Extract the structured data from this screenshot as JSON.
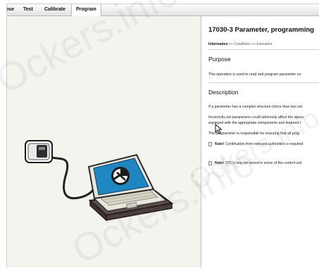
{
  "tabs": [
    {
      "label": "ose"
    },
    {
      "label": "Test"
    },
    {
      "label": "Calibrate"
    },
    {
      "label": "Program"
    }
  ],
  "right_panel": {
    "title": "17030-3 Parameter, programming",
    "breadcrumb": {
      "current": "Information",
      "sep1": ">>",
      "step2": "Conditions",
      "sep2": ">>",
      "step3": "Execution"
    },
    "purpose_heading": "Purpose",
    "purpose_text": "This operation is used to read and program parameter va",
    "description_heading": "Description",
    "description_lines": [
      "If a parameter has a complex structure (more than two val",
      "Incorrectly set parameters could adversely affect the opera",
      "equipped with the appropriate components and features t",
      "The programmer is responsible for ensuring that all prog"
    ],
    "notes": [
      {
        "label": "Note!",
        "text": "Certification from relevant authorities is required"
      },
      {
        "label": "Note!",
        "text": "DTCs may be stored in some of the control unit"
      }
    ]
  },
  "watermark": "Ockers.info",
  "icons": [
    "vocom-interface-icon",
    "laptop-tool-icon",
    "mouse-cursor-icon",
    "note-icon"
  ],
  "colors": {
    "left_pane_bg": "#f4f4ee",
    "laptop_screen": "#1f86c2",
    "laptop_body": "#e8e6dc",
    "laptop_base": "#5a4c4a"
  }
}
